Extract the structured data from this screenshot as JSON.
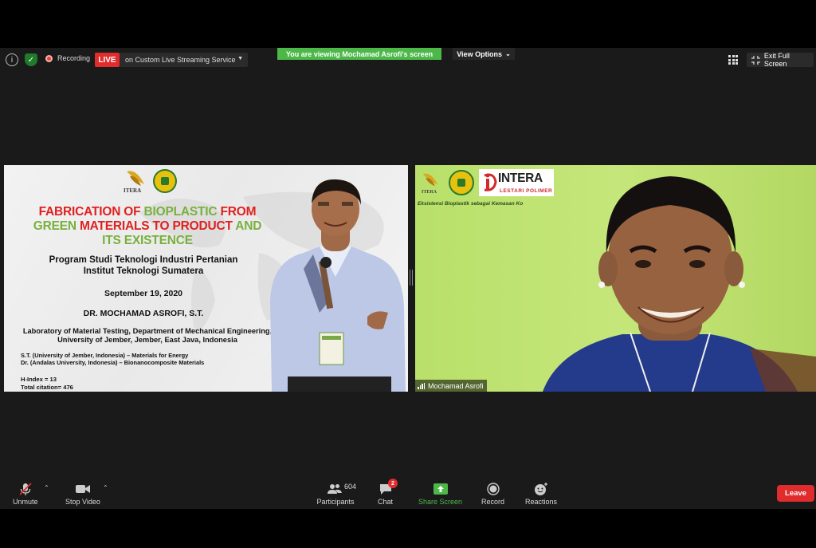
{
  "topbar": {
    "recording_label": "Recording",
    "live_label": "LIVE",
    "stream_service": "on Custom Live Streaming Service",
    "viewing_banner": "You are viewing Mochamad Asrofi's screen",
    "view_options_label": "View Options",
    "exit_fullscreen_label": "Exit Full Screen"
  },
  "slide": {
    "logo_text": "ITERA",
    "title": {
      "line1": [
        {
          "text": "FABRICATION OF ",
          "color": "red"
        },
        {
          "text": "BIOPLASTIC ",
          "color": "green"
        },
        {
          "text": "FROM",
          "color": "red"
        }
      ],
      "line2": [
        {
          "text": "GREEN ",
          "color": "green"
        },
        {
          "text": "MATERIALS TO PRODUCT ",
          "color": "red"
        },
        {
          "text": "AND",
          "color": "green"
        }
      ],
      "line3": [
        {
          "text": "ITS EXISTENCE",
          "color": "green"
        }
      ]
    },
    "program_line1": "Program Studi Teknologi Industri Pertanian",
    "program_line2": "Institut Teknologi Sumatera",
    "date": "September 19, 2020",
    "author": "DR. MOCHAMAD ASROFI, S.T.",
    "lab_line1": "Laboratory of Material Testing, Department of Mechanical Engineering,",
    "lab_line2": "University of Jember, Jember, East Java, Indonesia",
    "degree1": "S.T. (University of Jember, Indonesia) – Materials for Energy",
    "degree2": "Dr. (Andalas University, Indonesia) – Bionanocomposite Materials",
    "h_index": "H-Index = 13",
    "citations": "Total citation= 476"
  },
  "video": {
    "logo_text": "ITERA",
    "intera_word": "INTERA",
    "intera_sub": "LESTARI POLIMER",
    "caption": "Eksistensi Bioplastik sebagai Kemasan Ko",
    "participant_name": "Mochamad Asrofi"
  },
  "toolbar": {
    "unmute": "Unmute",
    "stop_video": "Stop Video",
    "participants": "Participants",
    "participants_count": "604",
    "chat": "Chat",
    "chat_badge": "2",
    "share_screen": "Share Screen",
    "record": "Record",
    "reactions": "Reactions",
    "leave": "Leave"
  },
  "colors": {
    "live_red": "#e02c2c",
    "banner_green": "#4cb848",
    "title_red": "#e02020",
    "title_green": "#79b03d",
    "video_bg": "#c1e474"
  },
  "icons": [
    "info-icon",
    "shield-icon",
    "record-dot-icon",
    "grid-view-icon",
    "exit-fullscreen-icon",
    "muted-mic-icon",
    "video-camera-icon",
    "participants-icon",
    "chat-icon",
    "share-screen-icon",
    "record-icon",
    "reactions-icon",
    "signal-icon"
  ]
}
